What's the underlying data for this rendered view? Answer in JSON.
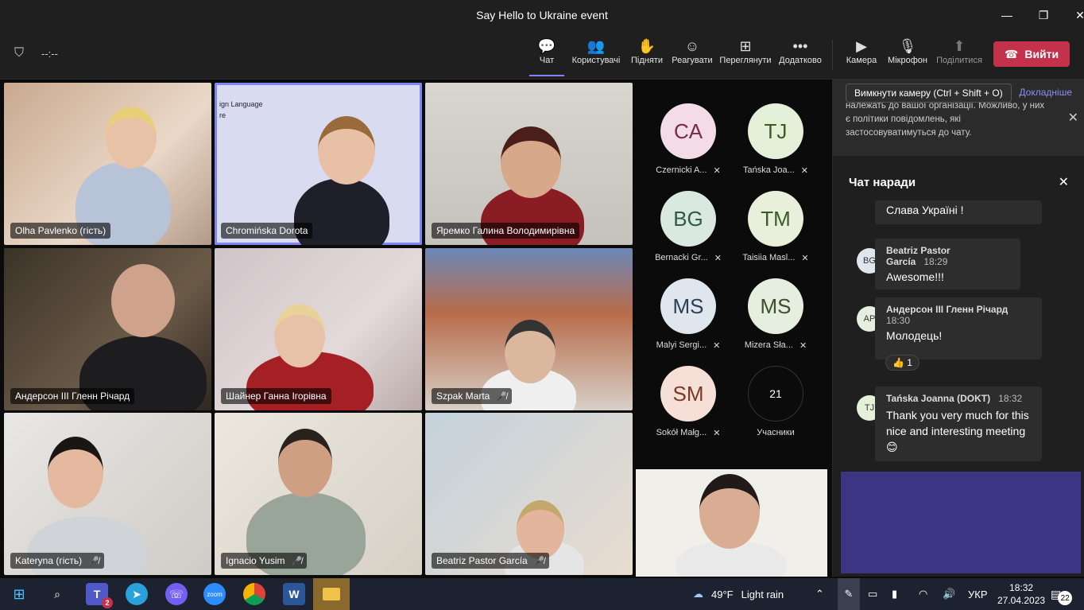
{
  "window": {
    "title": "Say Hello to Ukraine event"
  },
  "toolbar": {
    "timer": "--:--",
    "buttons": [
      {
        "label": "Чат"
      },
      {
        "label": "Користувачі"
      },
      {
        "label": "Підняти"
      },
      {
        "label": "Реагувати"
      },
      {
        "label": "Переглянути"
      },
      {
        "label": "Додатково"
      },
      {
        "label": "Камера"
      },
      {
        "label": "Мікрофон"
      },
      {
        "label": "Поділитися"
      }
    ],
    "leave_label": "Вийти"
  },
  "tooltip": "Вимкнути камеру (Ctrl + Shift + O)",
  "videos": [
    {
      "name": "Olha Pavlenko (гість)"
    },
    {
      "name": "Chromińska Dorota",
      "slide_text": "ign Language\nre"
    },
    {
      "name": "Яремко Галина Володимирівна"
    },
    {
      "name": "Андерсон III Гленн Річард"
    },
    {
      "name": "Шайнер Ганна Ігорівна"
    },
    {
      "name": "Szpak Marta"
    },
    {
      "name": "Kateryna (гість)"
    },
    {
      "name": "Ignacio Yusim"
    },
    {
      "name": "Beatriz Pastor García"
    }
  ],
  "roster": [
    {
      "initials": "CA",
      "name": "Czernicki A...",
      "color": "#f3dce6"
    },
    {
      "initials": "TJ",
      "name": "Tańska Joa...",
      "color": "#e5f0d9"
    },
    {
      "initials": "BG",
      "name": "Bernacki Gr...",
      "color": "#d9e8e0"
    },
    {
      "initials": "TM",
      "name": "Taisiia Masl...",
      "color": "#e8f0dc"
    },
    {
      "initials": "MS",
      "name": "Malyi Sergi...",
      "color": "#dfe6ee"
    },
    {
      "initials": "MS",
      "name": "Mizera Sła...",
      "color": "#e5eedf"
    },
    {
      "initials": "SM",
      "name": "Sokół Małg...",
      "color": "#f6dfd6"
    }
  ],
  "participants_count": "21",
  "participants_label": "Учасники",
  "chat": {
    "notice_link": "Докладніше",
    "notice": "належать до вашої організації. Можливо, у них є політики повідомлень, які застосовуватимуться до чату.",
    "title": "Чат наради",
    "messages": [
      {
        "text": "Слава Україні !"
      },
      {
        "initials": "BG",
        "author": "Beatriz Pastor García",
        "time": "18:29",
        "text": "Awesome!!!"
      },
      {
        "initials": "AP",
        "author": "Андерсон III Гленн Річард",
        "time": "18:30",
        "text": "Молодець!",
        "reaction": "1"
      },
      {
        "initials": "TJ",
        "author": "Tańska Joanna (DOKT)",
        "time": "18:32",
        "text": "Thank you very much for this nice and interesting meeting"
      }
    ]
  },
  "taskbar": {
    "teams_badge": "2",
    "weather_temp": "49°F",
    "weather_desc": "Light rain",
    "lang": "УКР",
    "time": "18:32",
    "date": "27.04.2023",
    "notif_count": "22"
  }
}
